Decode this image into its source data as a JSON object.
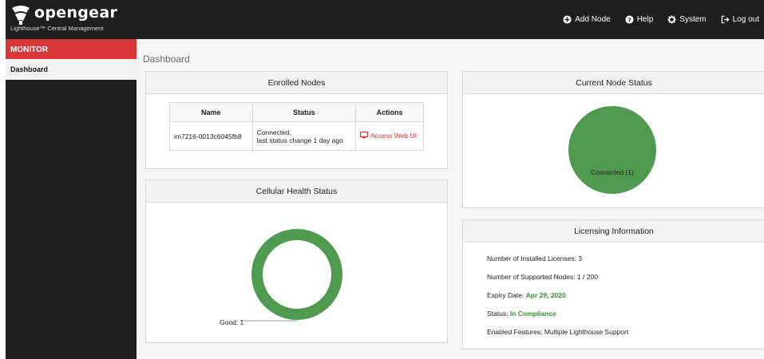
{
  "brand": {
    "name": "opengear",
    "tagline": "Lighthouse™ Central Management"
  },
  "top_nav": [
    {
      "label": "Add Node",
      "icon": "plus-circle-icon"
    },
    {
      "label": "Help",
      "icon": "question-circle-icon"
    },
    {
      "label": "System",
      "icon": "gear-icon"
    },
    {
      "label": "Log out",
      "icon": "logout-icon"
    }
  ],
  "sidebar": {
    "section": "MONITOR",
    "items": [
      {
        "label": "Dashboard",
        "active": true
      }
    ]
  },
  "page": {
    "title": "Dashboard"
  },
  "enrolled_nodes": {
    "title": "Enrolled Nodes",
    "columns": [
      "Name",
      "Status",
      "Actions"
    ],
    "rows": [
      {
        "name": "im7216-0013c6045fb8",
        "status_line1": "Connected,",
        "status_line2": "last status change 1 day ago",
        "action": "Access Web UI"
      }
    ]
  },
  "current_node_status": {
    "title": "Current Node Status",
    "label": "Connected (1)"
  },
  "cellular_health": {
    "title": "Cellular Health Status",
    "label": "Good: 1"
  },
  "licensing": {
    "title": "Licensing Information",
    "installed_label": "Number of Installed Licenses: 3",
    "supported_label": "Number of Supported Nodes: 1 / 200",
    "expiry_label": "Expiry Date: ",
    "expiry_value": "Apr 29, 2020",
    "status_label": "Status: ",
    "status_value": "In Compliance",
    "features_label": "Enabled Features: Multiple Lighthouse Support"
  },
  "colors": {
    "accent_red": "#d9383a",
    "chart_green": "#4f9a4f",
    "dark_bar": "#1e1e1e",
    "text_green": "#3b8e3b"
  },
  "chart_data": [
    {
      "type": "pie",
      "title": "Current Node Status",
      "categories": [
        "Connected"
      ],
      "values": [
        1
      ]
    },
    {
      "type": "pie",
      "title": "Cellular Health Status",
      "categories": [
        "Good"
      ],
      "values": [
        1
      ]
    }
  ]
}
